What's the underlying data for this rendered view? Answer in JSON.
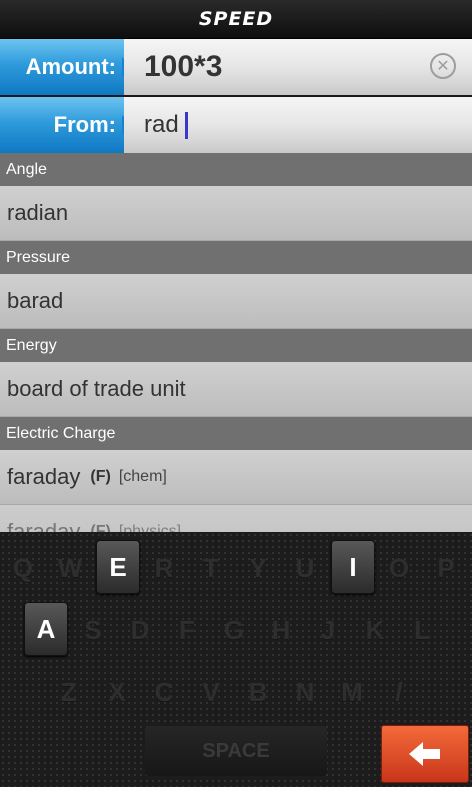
{
  "app": {
    "title": "SPEED"
  },
  "amount": {
    "label": "Amount:",
    "value": "100*3"
  },
  "from": {
    "label": "From:",
    "value": "rad"
  },
  "icons": {
    "clear": "close-circle-icon",
    "backspace": "backspace-arrow-icon"
  },
  "results": [
    {
      "category": "Angle",
      "unit": "radian",
      "symbol": "",
      "context": ""
    },
    {
      "category": "Pressure",
      "unit": "barad",
      "symbol": "",
      "context": ""
    },
    {
      "category": "Energy",
      "unit": "board of trade unit",
      "symbol": "",
      "context": ""
    },
    {
      "category": "Electric Charge",
      "unit": "faraday",
      "symbol": "(F)",
      "context": "[chem]"
    },
    {
      "category": "",
      "unit": "faraday",
      "symbol": "(F)",
      "context": "[physics]"
    }
  ],
  "keyboard": {
    "row1": [
      "Q",
      "W",
      "E",
      "R",
      "T",
      "Y",
      "U",
      "I",
      "O",
      "P"
    ],
    "row2": [
      "A",
      "S",
      "D",
      "F",
      "G",
      "H",
      "J",
      "K",
      "L"
    ],
    "row3": [
      "Z",
      "X",
      "C",
      "V",
      "B",
      "N",
      "M",
      "/"
    ],
    "lit_keys": [
      "E",
      "I",
      "A"
    ],
    "space_label": "SPACE"
  },
  "colors": {
    "accent_blue": "#2e9bdc",
    "backspace_orange": "#e4532a",
    "section_grey": "#707070"
  }
}
